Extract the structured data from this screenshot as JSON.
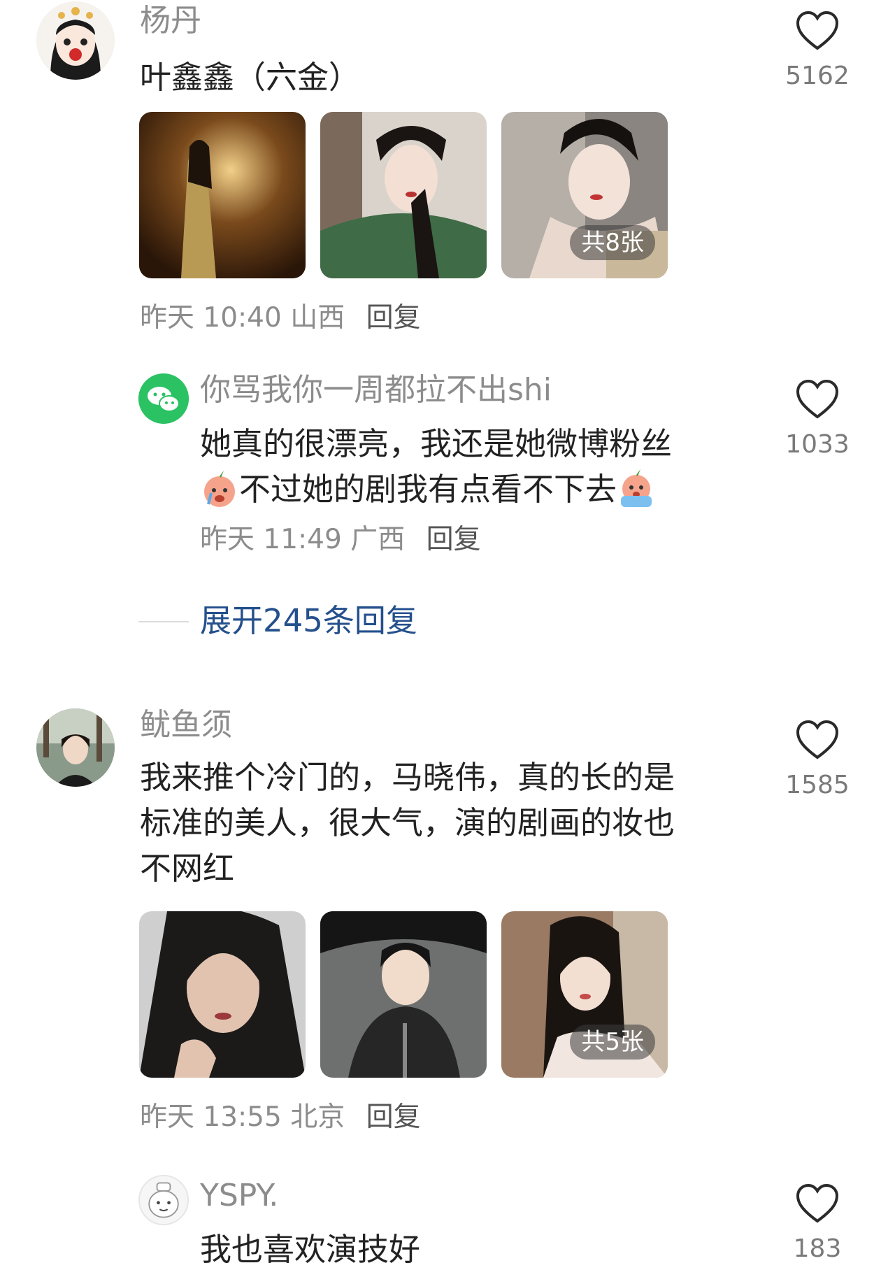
{
  "comments": [
    {
      "username": "杨丹",
      "text": "叶鑫鑫（六金）",
      "photo_badge": "共8张",
      "time": "昨天 10:40",
      "location": "山西",
      "reply_label": "回复",
      "likes": "5162",
      "avatar_icon": "cartoon-girl-avatar"
    },
    {
      "username": "你骂我你一周都拉不出shi",
      "text_line1": "她真的很漂亮，我还是她微博粉丝",
      "text_line2": "不过她的剧我有点看不下去",
      "time": "昨天 11:49",
      "location": "广西",
      "reply_label": "回复",
      "likes": "1033",
      "avatar_icon": "wechat-icon"
    },
    {
      "username": "鱿鱼须",
      "text_line1": "我来推个冷门的，马晓伟，真的长的是",
      "text_line2": "标准的美人，很大气，演的剧画的妆也",
      "text_line3": "不网红",
      "photo_badge": "共5张",
      "time": "昨天 13:55",
      "location": "北京",
      "reply_label": "回复",
      "likes": "1585",
      "avatar_icon": "photo-avatar"
    },
    {
      "username": "YSPY.",
      "text": "我也喜欢演技好",
      "likes": "183",
      "avatar_icon": "cute-character-avatar"
    }
  ],
  "expand_replies": "展开245条回复",
  "colors": {
    "username": "#8c8c8c",
    "link": "#24508c",
    "text": "#222222"
  }
}
